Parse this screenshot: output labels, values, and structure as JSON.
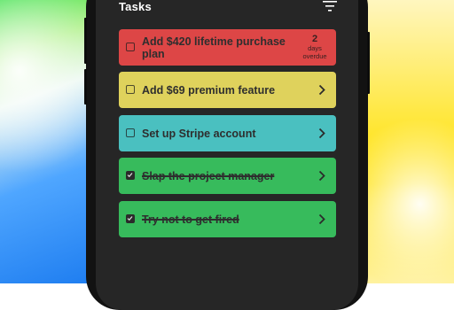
{
  "header": {
    "title": "Tasks",
    "filter_icon": "filter-icon"
  },
  "tasks": [
    {
      "label": "Add $420 lifetime purchase plan",
      "color": "#dd4646",
      "completed": false,
      "due": {
        "number": "2",
        "unit": "days",
        "status": "overdue"
      }
    },
    {
      "label": "Add $69 premium feature",
      "color": "#dfd25c",
      "completed": false
    },
    {
      "label": "Set up Stripe account",
      "color": "#4ac0c0",
      "completed": false
    },
    {
      "label": "Slap the project manager",
      "color": "#37bb5c",
      "completed": true
    },
    {
      "label": "Try not to get fired",
      "color": "#37bb5c",
      "completed": true
    }
  ]
}
